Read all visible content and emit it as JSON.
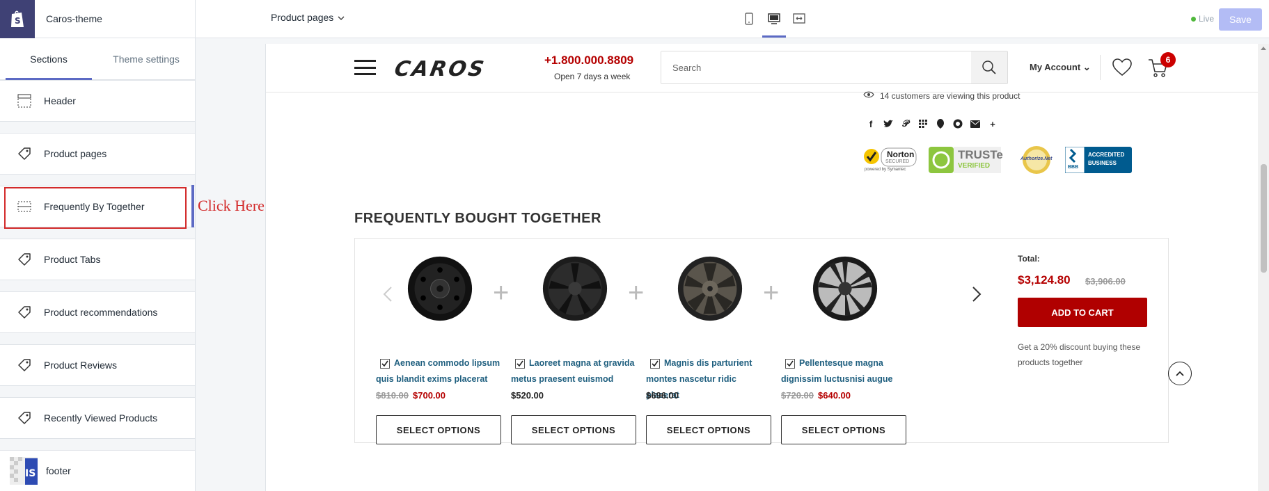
{
  "app": {
    "theme_name": "Caros-theme",
    "page_selector": "Product pages",
    "status": "Live",
    "save_label": "Save",
    "accent": "#5c6ac4"
  },
  "sidebar": {
    "tabs": [
      {
        "label": "Sections",
        "active": true
      },
      {
        "label": "Theme settings",
        "active": false
      }
    ],
    "items": [
      {
        "label": "Header",
        "icon": "header-layout-icon"
      },
      {
        "label": "Product pages",
        "icon": "tag-icon"
      },
      {
        "label": "Frequently By Together",
        "icon": "section-layout-icon"
      },
      {
        "label": "Product Tabs",
        "icon": "tag-icon"
      },
      {
        "label": "Product recommendations",
        "icon": "tag-icon"
      },
      {
        "label": "Product Reviews",
        "icon": "tag-icon"
      },
      {
        "label": "Recently Viewed Products",
        "icon": "tag-icon"
      },
      {
        "label": "footer",
        "icon": "footer-thumbnail"
      }
    ],
    "annotation": "Click Here"
  },
  "store": {
    "logo_text": "CAROS",
    "phone": "+1.800.000.8809",
    "phone_sub": "Open 7 days a week",
    "search_placeholder": "Search",
    "account_label": "My Account",
    "cart_count": "6",
    "viewers_text": "14 customers are viewing this product",
    "social_icons": [
      "facebook-icon",
      "twitter-icon",
      "pinterest-icon",
      "grid-icon",
      "tumblr-icon",
      "reddit-icon",
      "email-icon",
      "more-icon"
    ],
    "trust_badges": {
      "norton": {
        "line1": "Norton",
        "line2": "SECURED",
        "line3": "powered by Symantec"
      },
      "truste": {
        "line1": "TRUSTe",
        "line2": "VERIFIED"
      },
      "authorize": {
        "line1": "Authorize.Net"
      },
      "bbb": {
        "line1": "BBB",
        "line2": "ACCREDITED",
        "line3": "BUSINESS"
      }
    }
  },
  "fbt": {
    "title": "FREQUENTLY BOUGHT TOGETHER",
    "products": [
      {
        "name": "Aenean commodo lipsum quis blandit exims placerat",
        "old_price": "$810.00",
        "price": "$700.00",
        "on_sale": true,
        "button": "SELECT OPTIONS",
        "checked": true
      },
      {
        "name": "Laoreet magna at gravida metus praesent euismod",
        "old_price": "",
        "price": "$520.00",
        "on_sale": false,
        "button": "SELECT OPTIONS",
        "checked": true
      },
      {
        "name": "Magnis dis parturient montes nascetur ridic placerat",
        "old_price": "",
        "price": "$696.00",
        "on_sale": false,
        "button": "SELECT OPTIONS",
        "checked": true
      },
      {
        "name": "Pellentesque magna dignissim luctusnisi augue",
        "old_price": "$720.00",
        "price": "$640.00",
        "on_sale": true,
        "button": "SELECT OPTIONS",
        "checked": true
      }
    ],
    "total_label": "Total:",
    "total_price": "$3,124.80",
    "total_old_price": "$3,906.00",
    "add_to_cart": "ADD TO CART",
    "discount_text": "Get a 20% discount buying these products together"
  }
}
